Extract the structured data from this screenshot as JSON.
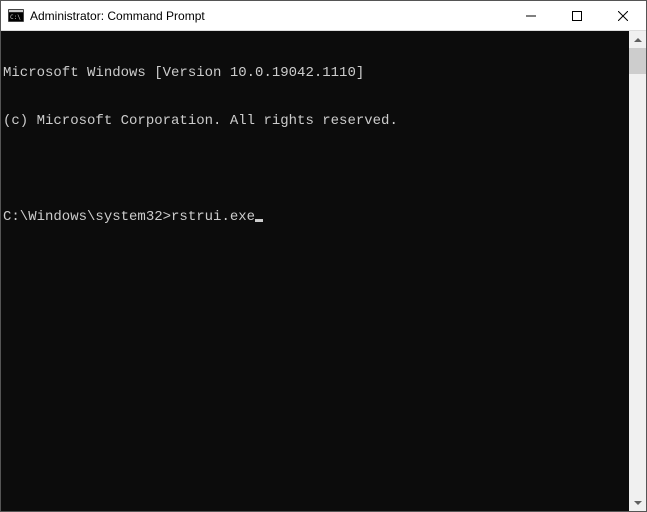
{
  "window": {
    "title": "Administrator: Command Prompt"
  },
  "terminal": {
    "header_line_1": "Microsoft Windows [Version 10.0.19042.1110]",
    "header_line_2": "(c) Microsoft Corporation. All rights reserved.",
    "prompt": "C:\\Windows\\system32>",
    "command": "rstrui.exe"
  },
  "colors": {
    "terminal_bg": "#0c0c0c",
    "terminal_fg": "#cccccc"
  }
}
